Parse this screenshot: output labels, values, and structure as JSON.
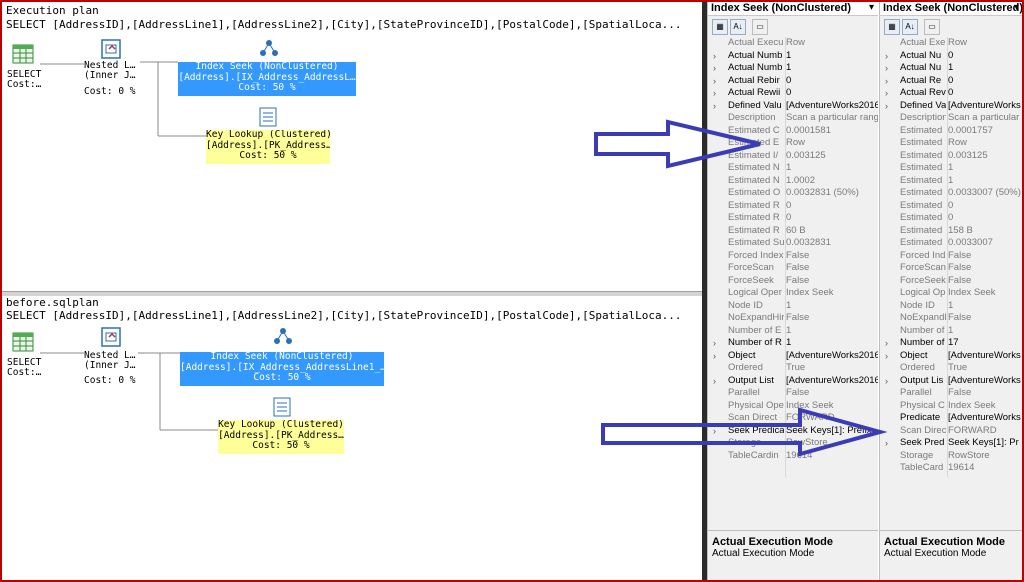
{
  "plan_top": {
    "title": "Execution plan",
    "query": "SELECT [AddressID],[AddressLine1],[AddressLine2],[City],[StateProvinceID],[PostalCode],[SpatialLoca...",
    "select_label": "SELECT\nCost:…",
    "nested_label": "Nested L…\n(Inner J…",
    "nested_cost": "Cost: 0 %",
    "index_seek": {
      "line1": "Index Seek (NonClustered)",
      "line2": "[Address].[IX_Address_AddressL…",
      "line3": "Cost: 50 %"
    },
    "key_lookup": {
      "line1": "Key Lookup (Clustered)",
      "line2": "[Address].[PK_Address…",
      "line3": "Cost: 50 %"
    }
  },
  "plan_bottom": {
    "title": "before.sqlplan",
    "query": "SELECT [AddressID],[AddressLine1],[AddressLine2],[City],[StateProvinceID],[PostalCode],[SpatialLoca...",
    "select_label": "SELECT\nCost:…",
    "nested_label": "Nested L…\n(Inner J…",
    "nested_cost": "Cost: 0 %",
    "index_seek": {
      "line1": "Index Seek (NonClustered)",
      "line2": "[Address].[IX_Address_AddressLine1_…",
      "line3": "Cost: 50 %"
    },
    "key_lookup": {
      "line1": "Key Lookup (Clustered)",
      "line2": "[Address].[PK_Address…",
      "line3": "Cost: 50 %"
    }
  },
  "left_props": {
    "header": "Index Seek (NonClustered)",
    "rows": [
      {
        "name": "Actual Execu",
        "value": "Row",
        "expand": false,
        "dim": true
      },
      {
        "name": "Actual Numb",
        "value": "1",
        "expand": true,
        "dim": false
      },
      {
        "name": "Actual Numb",
        "value": "1",
        "expand": true,
        "dim": false
      },
      {
        "name": "Actual Rebir",
        "value": "0",
        "expand": true,
        "dim": false
      },
      {
        "name": "Actual Rewii",
        "value": "0",
        "expand": true,
        "dim": false
      },
      {
        "name": "Defined Valu",
        "value": "[AdventureWorks2016",
        "expand": true,
        "dim": false
      },
      {
        "name": "Description",
        "value": "Scan a particular rang",
        "expand": false,
        "dim": true
      },
      {
        "name": "Estimated C",
        "value": "0.0001581",
        "expand": false,
        "dim": true
      },
      {
        "name": "Estimated E",
        "value": "Row",
        "expand": false,
        "dim": true
      },
      {
        "name": "Estimated I/",
        "value": "0.003125",
        "expand": false,
        "dim": true
      },
      {
        "name": "Estimated N",
        "value": "1",
        "expand": false,
        "dim": true
      },
      {
        "name": "Estimated N",
        "value": "1.0002",
        "expand": false,
        "dim": true
      },
      {
        "name": "Estimated O",
        "value": "0.0032831 (50%)",
        "expand": false,
        "dim": true
      },
      {
        "name": "Estimated R",
        "value": "0",
        "expand": false,
        "dim": true
      },
      {
        "name": "Estimated R",
        "value": "0",
        "expand": false,
        "dim": true
      },
      {
        "name": "Estimated R",
        "value": "60 B",
        "expand": false,
        "dim": true
      },
      {
        "name": "Estimated Su",
        "value": "0.0032831",
        "expand": false,
        "dim": true
      },
      {
        "name": "Forced Index",
        "value": "False",
        "expand": false,
        "dim": true
      },
      {
        "name": "ForceScan",
        "value": "False",
        "expand": false,
        "dim": true
      },
      {
        "name": "ForceSeek",
        "value": "False",
        "expand": false,
        "dim": true
      },
      {
        "name": "Logical Oper",
        "value": "Index Seek",
        "expand": false,
        "dim": true
      },
      {
        "name": "Node ID",
        "value": "1",
        "expand": false,
        "dim": true
      },
      {
        "name": "NoExpandHir",
        "value": "False",
        "expand": false,
        "dim": true
      },
      {
        "name": "Number of E",
        "value": "1",
        "expand": false,
        "dim": true
      },
      {
        "name": "Number of R",
        "value": "1",
        "expand": true,
        "dim": false
      },
      {
        "name": "Object",
        "value": "[AdventureWorks2016",
        "expand": true,
        "dim": false
      },
      {
        "name": "Ordered",
        "value": "True",
        "expand": false,
        "dim": true
      },
      {
        "name": "Output List",
        "value": "[AdventureWorks2016",
        "expand": true,
        "dim": false
      },
      {
        "name": "Parallel",
        "value": "False",
        "expand": false,
        "dim": true
      },
      {
        "name": "Physical Ope",
        "value": "Index Seek",
        "expand": false,
        "dim": true
      },
      {
        "name": "Scan Direct",
        "value": "FORWARD",
        "expand": false,
        "dim": true
      },
      {
        "name": "Seek Predica",
        "value": "Seek Keys[1]: Prefix",
        "expand": true,
        "dim": false
      },
      {
        "name": "Storage",
        "value": "RowStore",
        "expand": false,
        "dim": true
      },
      {
        "name": "TableCardin",
        "value": "19614",
        "expand": false,
        "dim": true
      }
    ],
    "desc_title": "Actual Execution Mode",
    "desc_text": "Actual Execution Mode"
  },
  "right_props": {
    "header": "Index Seek (NonClustered)",
    "rows": [
      {
        "name": "Actual Exe",
        "value": "Row",
        "expand": false,
        "dim": true
      },
      {
        "name": "Actual Nu",
        "value": "0",
        "expand": true,
        "dim": false
      },
      {
        "name": "Actual Nu",
        "value": "1",
        "expand": true,
        "dim": false
      },
      {
        "name": "Actual Re",
        "value": "0",
        "expand": true,
        "dim": false
      },
      {
        "name": "Actual Rev",
        "value": "0",
        "expand": true,
        "dim": false
      },
      {
        "name": "Defined Va",
        "value": "[AdventureWorks",
        "expand": true,
        "dim": false
      },
      {
        "name": "Description",
        "value": "Scan a particular",
        "expand": false,
        "dim": true
      },
      {
        "name": "Estimated",
        "value": "0.0001757",
        "expand": false,
        "dim": true
      },
      {
        "name": "Estimated",
        "value": "Row",
        "expand": false,
        "dim": true
      },
      {
        "name": "Estimated",
        "value": "0.003125",
        "expand": false,
        "dim": true
      },
      {
        "name": "Estimated",
        "value": "1",
        "expand": false,
        "dim": true
      },
      {
        "name": "Estimated",
        "value": "1",
        "expand": false,
        "dim": true
      },
      {
        "name": "Estimated",
        "value": "0.0033007 (50%)",
        "expand": false,
        "dim": true
      },
      {
        "name": "Estimated",
        "value": "0",
        "expand": false,
        "dim": true
      },
      {
        "name": "Estimated",
        "value": "0",
        "expand": false,
        "dim": true
      },
      {
        "name": "Estimated",
        "value": "158 B",
        "expand": false,
        "dim": true
      },
      {
        "name": "Estimated",
        "value": "0.0033007",
        "expand": false,
        "dim": true
      },
      {
        "name": "Forced Ind",
        "value": "False",
        "expand": false,
        "dim": true
      },
      {
        "name": "ForceScan",
        "value": "False",
        "expand": false,
        "dim": true
      },
      {
        "name": "ForceSeek",
        "value": "False",
        "expand": false,
        "dim": true
      },
      {
        "name": "Logical Op",
        "value": "Index Seek",
        "expand": false,
        "dim": true
      },
      {
        "name": "Node ID",
        "value": "1",
        "expand": false,
        "dim": true
      },
      {
        "name": "NoExpandH",
        "value": "False",
        "expand": false,
        "dim": true
      },
      {
        "name": "Number of",
        "value": "1",
        "expand": false,
        "dim": true
      },
      {
        "name": "Number of",
        "value": "17",
        "expand": true,
        "dim": false
      },
      {
        "name": "Object",
        "value": "[AdventureWorks",
        "expand": true,
        "dim": false
      },
      {
        "name": "Ordered",
        "value": "True",
        "expand": false,
        "dim": true
      },
      {
        "name": "Output Lis",
        "value": "[AdventureWorks",
        "expand": true,
        "dim": false
      },
      {
        "name": "Parallel",
        "value": "False",
        "expand": false,
        "dim": true
      },
      {
        "name": "Physical C",
        "value": "Index Seek",
        "expand": false,
        "dim": true
      },
      {
        "name": "Predicate",
        "value": "[AdventureWorks",
        "expand": false,
        "dim": false
      },
      {
        "name": "Scan Direc",
        "value": "FORWARD",
        "expand": false,
        "dim": true
      },
      {
        "name": "Seek Pred",
        "value": "Seek Keys[1]: Pr",
        "expand": true,
        "dim": false
      },
      {
        "name": "Storage",
        "value": "RowStore",
        "expand": false,
        "dim": true
      },
      {
        "name": "TableCard",
        "value": "19614",
        "expand": false,
        "dim": true
      }
    ],
    "desc_title": "Actual Execution Mode",
    "desc_text": "Actual Execution Mode"
  },
  "colors": {
    "frame": "#c00000",
    "seek_blue": "#3399ff",
    "lookup_yellow": "#ffff99",
    "arrow": "#3b3bb5"
  }
}
